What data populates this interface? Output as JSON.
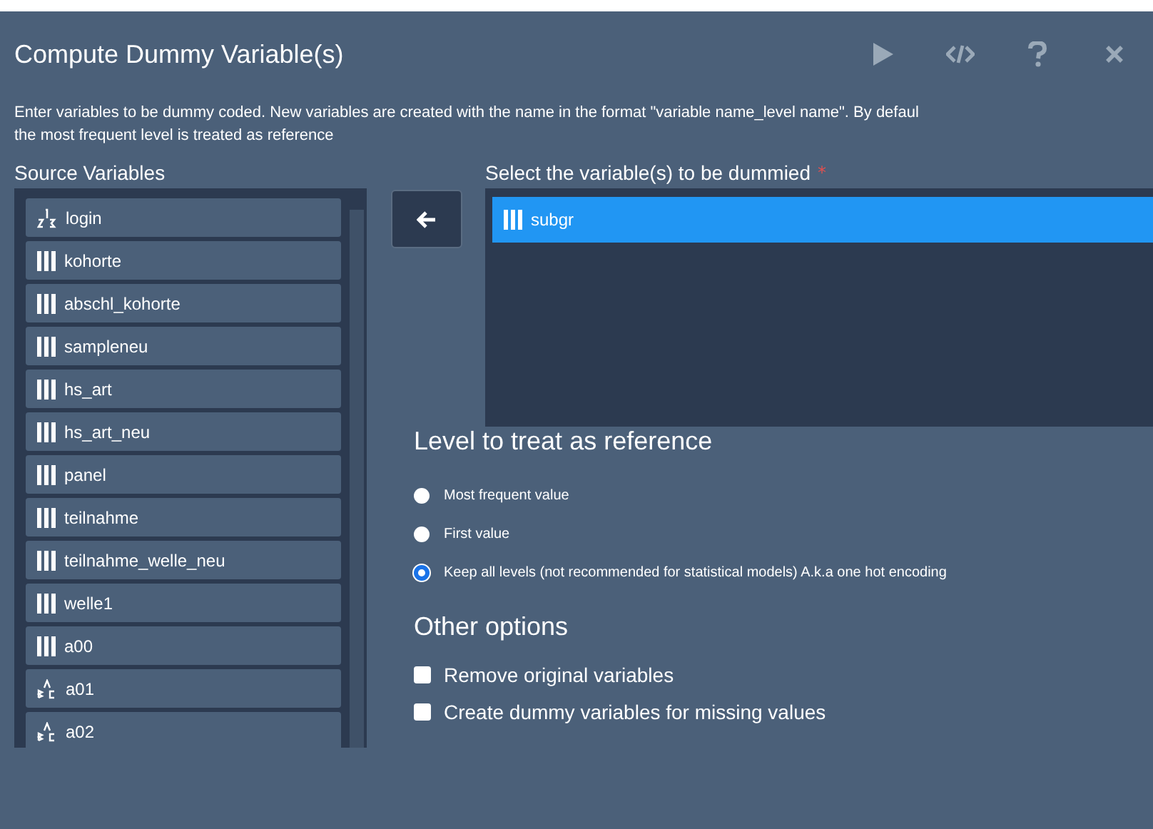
{
  "window": {
    "title": "Compute Dummy Variable(s)"
  },
  "toolbar": [
    {
      "kind": "run"
    },
    {
      "kind": "code"
    },
    {
      "kind": "help"
    },
    {
      "kind": "close"
    }
  ],
  "description_lines": [
    "Enter variables to be dummy coded. New variables are created with the name in the format \"variable name_level name\". By defaul",
    "the most frequent level is treated as reference"
  ],
  "source": {
    "label": "Source Variables",
    "items": [
      {
        "name": "login",
        "kind": "scale"
      },
      {
        "name": "kohorte",
        "kind": "ordinal"
      },
      {
        "name": "abschl_kohorte",
        "kind": "ordinal"
      },
      {
        "name": "sampleneu",
        "kind": "ordinal"
      },
      {
        "name": "hs_art",
        "kind": "ordinal"
      },
      {
        "name": "hs_art_neu",
        "kind": "ordinal"
      },
      {
        "name": "panel",
        "kind": "ordinal"
      },
      {
        "name": "teilnahme",
        "kind": "ordinal"
      },
      {
        "name": "teilnahme_welle_neu",
        "kind": "ordinal"
      },
      {
        "name": "welle1",
        "kind": "ordinal"
      },
      {
        "name": "a00",
        "kind": "ordinal"
      },
      {
        "name": "a01",
        "kind": "string"
      },
      {
        "name": "a02",
        "kind": "string"
      }
    ]
  },
  "target": {
    "label": "Select the variable(s) to be dummied",
    "required_mark": "*",
    "items": [
      {
        "name": "subgr",
        "kind": "ordinal",
        "selected": true
      }
    ]
  },
  "reference": {
    "heading": "Level to treat as reference",
    "options": [
      {
        "label": "Most frequent value",
        "selected": false
      },
      {
        "label": "First value",
        "selected": false
      },
      {
        "label": "Keep all levels (not recommended for statistical models) A.k.a one hot encoding",
        "selected": true
      }
    ]
  },
  "other": {
    "heading": "Other options",
    "options": [
      {
        "label": "Remove original variables",
        "checked": false
      },
      {
        "label": "Create dummy variables for missing values",
        "checked": false
      }
    ]
  }
}
